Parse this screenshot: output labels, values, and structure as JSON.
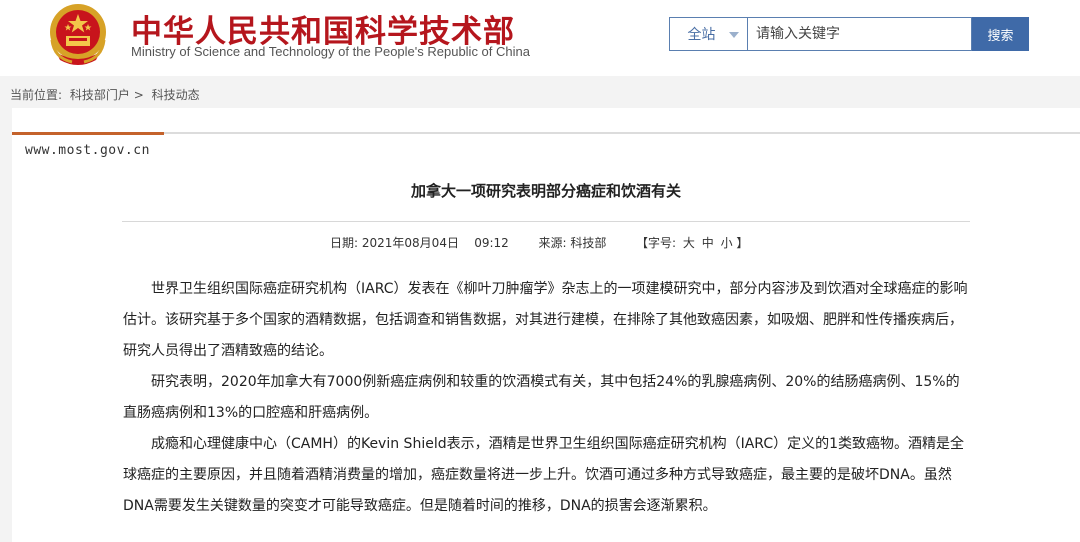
{
  "header": {
    "title": "中华人民共和国科学技术部",
    "subtitle": "Ministry of Science and Technology of the People's Republic of China",
    "emblem_icon": "national-emblem-icon"
  },
  "search": {
    "scope_label": "全站",
    "placeholder": "请输入关键字",
    "button_label": "搜索"
  },
  "breadcrumb": {
    "prefix": "当前位置:",
    "items": [
      "科技部门户",
      "科技动态"
    ],
    "separator": ">"
  },
  "panel": {
    "domain": "www.most.gov.cn"
  },
  "article": {
    "title": "加拿大一项研究表明部分癌症和饮酒有关",
    "date_label": "日期:",
    "date_value": "2021年08月04日    09:12",
    "source_label": "来源:",
    "source_value": "科技部",
    "font_size_label": "【字号:",
    "font_sizes": [
      "大",
      "中",
      "小"
    ],
    "font_size_close": "】",
    "paragraphs": [
      "世界卫生组织国际癌症研究机构（IARC）发表在《柳叶刀肿瘤学》杂志上的一项建模研究中，部分内容涉及到饮酒对全球癌症的影响估计。该研究基于多个国家的酒精数据，包括调查和销售数据，对其进行建模，在排除了其他致癌因素，如吸烟、肥胖和性传播疾病后，研究人员得出了酒精致癌的结论。",
      "研究表明，2020年加拿大有7000例新癌症病例和较重的饮酒模式有关，其中包括24%的乳腺癌病例、20%的结肠癌病例、15%的直肠癌病例和13%的口腔癌和肝癌病例。",
      "成瘾和心理健康中心（CAMH）的Kevin Shield表示，酒精是世界卫生组织国际癌症研究机构（IARC）定义的1类致癌物。酒精是全球癌症的主要原因，并且随着酒精消费量的增加，癌症数量将进一步上升。饮酒可通过多种方式导致癌症，最主要的是破坏DNA。虽然DNA需要发生关键数量的突变才可能导致癌症。但是随着时间的推移，DNA的损害会逐渐累积。"
    ]
  },
  "colors": {
    "brand_red": "#b5161d",
    "search_blue": "#3f6aa8",
    "accent_orange": "#c4622b"
  }
}
